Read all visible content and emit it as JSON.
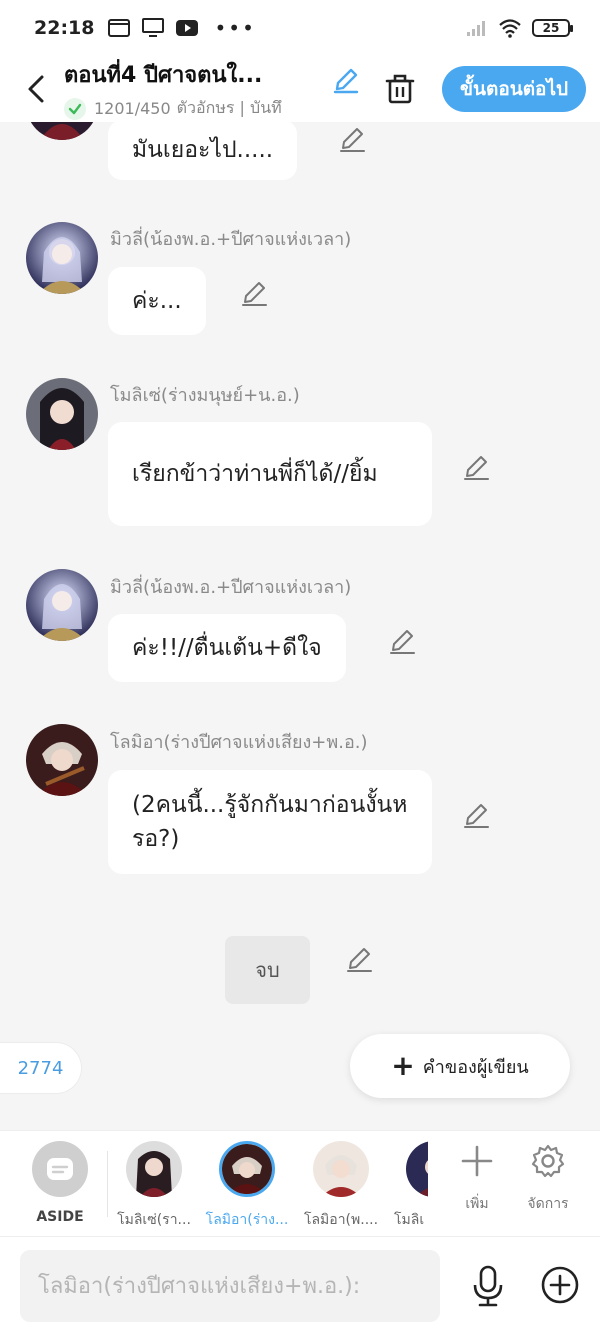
{
  "status_bar": {
    "time": "22:18",
    "battery": "25"
  },
  "header": {
    "title": "ตอนที่4 ปีศาจตนใ...",
    "char_count": "1201/450",
    "subtitle_rest": "ตัวอักษร | บันทึ",
    "next_button": "ขั้นตอนต่อไป",
    "accent_color": "#4aa8f0"
  },
  "messages": [
    {
      "speaker": "",
      "text": "มันเยอะไป....."
    },
    {
      "speaker": "มิวลี่(น้องพ.อ.+ปีศาจแห่งเวลา)",
      "text": "ค่ะ..."
    },
    {
      "speaker": "โมลิเซ่(ร่างมนุษย์+น.อ.)",
      "text": "เรียกข้าว่าท่านพี่ก็ได้//ยิ้ม"
    },
    {
      "speaker": "มิวลี่(น้องพ.อ.+ปีศาจแห่งเวลา)",
      "text": "ค่ะ!!//ตื่นเต้น+ดีใจ"
    },
    {
      "speaker": "โลมิอา(ร่างปีศาจแห่งเสียง+พ.อ.)",
      "text": "(2คนนี้...รู้จักกันมาก่อนงั้นหรอ?)"
    }
  ],
  "end_marker": "จบ",
  "word_count": "2774",
  "author_note_button": "คำของผู้เขียน",
  "characters": {
    "aside_label": "ASIDE",
    "items": [
      {
        "label": "โมลิเซ่(รา...",
        "selected": false
      },
      {
        "label": "โลมิอา(ร่าง...",
        "selected": true
      },
      {
        "label": "โลมิอา(พ....",
        "selected": false
      },
      {
        "label": "โมลิเ",
        "selected": false
      }
    ],
    "add_label": "เพิ่ม",
    "manage_label": "จัดการ"
  },
  "input": {
    "placeholder": "โลมิอา(ร่างปีศาจแห่งเสียง+พ.อ.):"
  }
}
